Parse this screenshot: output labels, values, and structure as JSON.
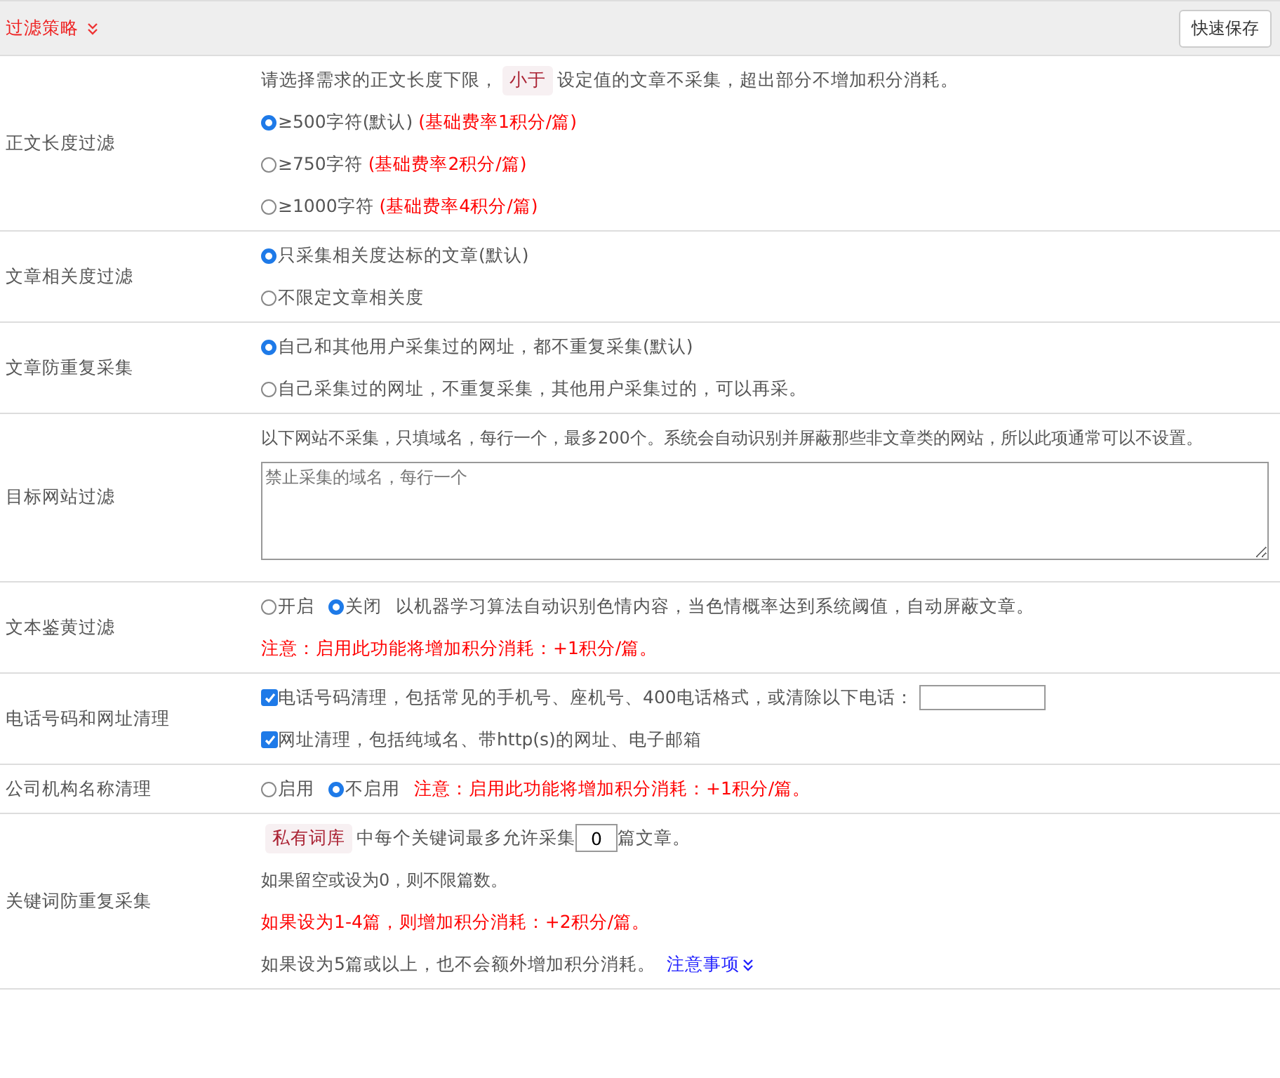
{
  "header": {
    "title": "过滤策略",
    "expanded": true,
    "save_button": "快速保存"
  },
  "sections": [
    {
      "label": "正文长度过滤",
      "items": [
        {
          "kind": "tagged",
          "before": "请选择需求的正文长度下限，",
          "tag": "小于",
          "after": "设定值的文章不采集，超出部分不增加积分消耗。"
        },
        {
          "kind": "radio",
          "label": "≥500字符(默认)",
          "note": "(基础费率1积分/篇)",
          "selected": true
        },
        {
          "kind": "radio",
          "label": "≥750字符",
          "note": "(基础费率2积分/篇)",
          "selected": false
        },
        {
          "kind": "radio",
          "label": "≥1000字符",
          "note": "(基础费率4积分/篇)",
          "selected": false
        }
      ]
    },
    {
      "label": "文章相关度过滤",
      "items": [
        {
          "kind": "radio",
          "label": "只采集相关度达标的文章(默认)",
          "selected": true
        },
        {
          "kind": "radio",
          "label": "不限定文章相关度",
          "selected": false
        }
      ]
    },
    {
      "label": "文章防重复采集",
      "items": [
        {
          "kind": "radio",
          "label": "自己和其他用户采集过的网址，都不重复采集(默认)",
          "selected": true
        },
        {
          "kind": "radio",
          "label": "自己采集过的网址，不重复采集，其他用户采集过的，可以再采。",
          "selected": false
        }
      ]
    },
    {
      "label": "目标网站过滤",
      "items": [
        {
          "kind": "text",
          "text": "以下网站不采集，只填域名，每行一个，最多200个。系统会自动识别并屏蔽那些非文章类的网站，所以此项通常可以不设置。"
        },
        {
          "kind": "textarea",
          "placeholder": "禁止采集的域名，每行一个"
        }
      ]
    },
    {
      "label": "文本鉴黄过滤",
      "items": [
        {
          "kind": "radio_inline",
          "options": [
            {
              "label": "开启",
              "selected": false
            },
            {
              "label": "关闭",
              "selected": true
            }
          ],
          "text": "以机器学习算法自动识别色情内容，当色情概率达到系统阈值，自动屏蔽文章。"
        },
        {
          "kind": "warning",
          "text": "注意：启用此功能将增加积分消耗：+1积分/篇。"
        }
      ]
    },
    {
      "label": "电话号码和网址清理",
      "items": [
        {
          "kind": "checkbox",
          "label": "电话号码清理，包括常见的手机号、座机号、400电话格式，或清除以下电话：",
          "checked": true,
          "field": true
        },
        {
          "kind": "checkbox",
          "label": "网址清理，包括纯域名、带http(s)的网址、电子邮箱",
          "checked": true
        }
      ]
    },
    {
      "label": "公司机构名称清理",
      "items": [
        {
          "kind": "radio_inline",
          "options": [
            {
              "label": "启用",
              "selected": false
            },
            {
              "label": "不启用",
              "selected": true
            }
          ],
          "warning": "注意：启用此功能将增加积分消耗：+1积分/篇。"
        }
      ]
    },
    {
      "label": "关键词防重复采集",
      "items": [
        {
          "kind": "tag_input",
          "tag": "私有词库",
          "before": "中每个关键词最多允许采集",
          "value": "0",
          "after": "篇文章。"
        },
        {
          "kind": "text",
          "text": "如果留空或设为0，则不限篇数。"
        },
        {
          "kind": "warning",
          "text": "如果设为1-4篇，则增加积分消耗：+2积分/篇。"
        },
        {
          "kind": "text_link",
          "text": "如果设为5篇或以上，也不会额外增加积分消耗。",
          "link": "注意事项"
        }
      ]
    }
  ]
}
